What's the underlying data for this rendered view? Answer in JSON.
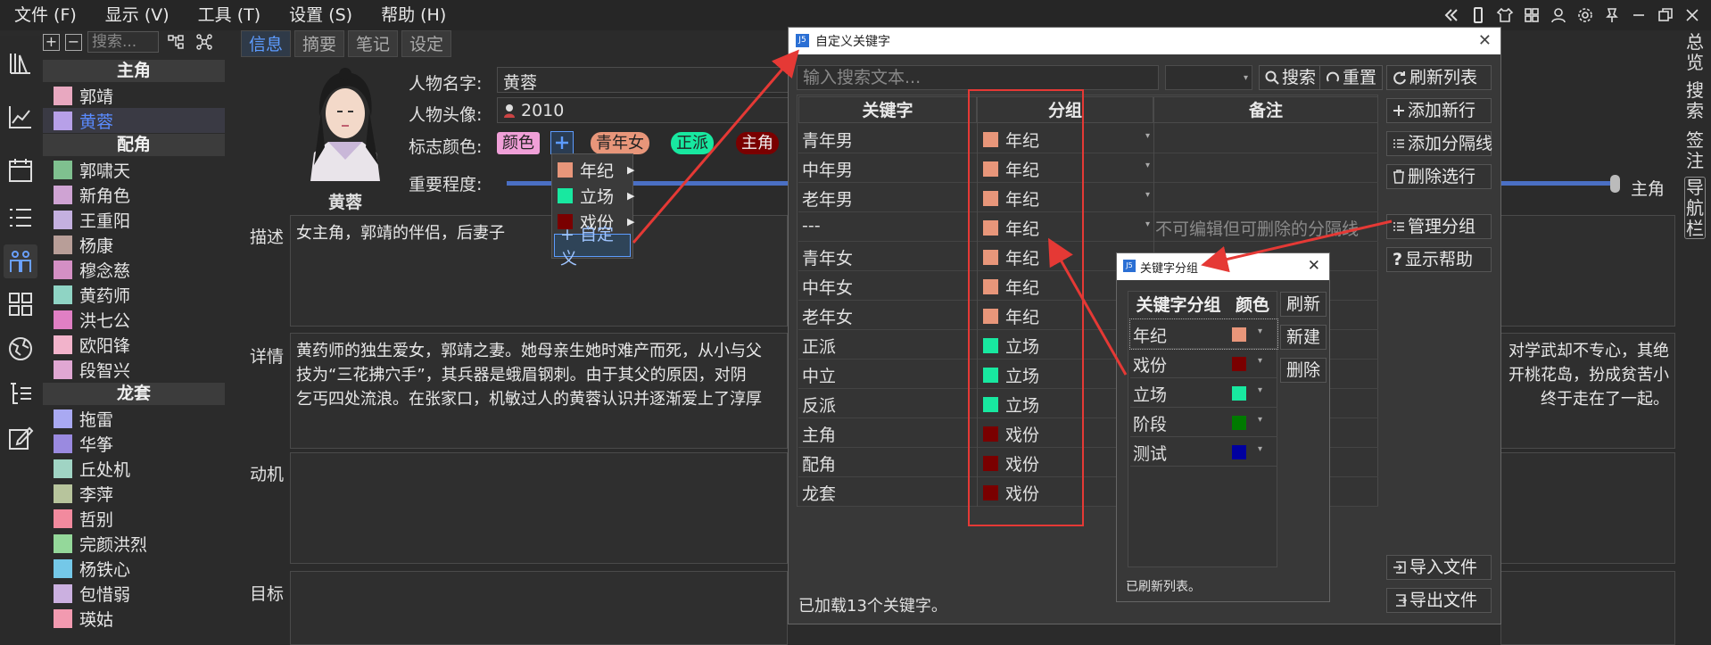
{
  "menubar": {
    "items": [
      "文件 (F)",
      "显示 (V)",
      "工具 (T)",
      "设置 (S)",
      "帮助 (H)"
    ]
  },
  "tree": {
    "search_placeholder": "搜索...",
    "groups": [
      {
        "name": "主角",
        "items": [
          {
            "label": "郭靖",
            "color": "#e8a8c0"
          },
          {
            "label": "黄蓉",
            "color": "#b7a0e8",
            "selected": true
          }
        ]
      },
      {
        "name": "配角",
        "items": [
          {
            "label": "郭啸天",
            "color": "#7fc08f"
          },
          {
            "label": "新角色",
            "color": "#cfa3d3"
          },
          {
            "label": "王重阳",
            "color": "#c4b0e0"
          },
          {
            "label": "杨康",
            "color": "#b89e98"
          },
          {
            "label": "穆念慈",
            "color": "#d48fc4"
          },
          {
            "label": "黄药师",
            "color": "#8fd4c4"
          },
          {
            "label": "洪七公",
            "color": "#e07fc4"
          },
          {
            "label": "欧阳锋",
            "color": "#f2b3cb"
          },
          {
            "label": "段智兴",
            "color": "#e0a7d3"
          }
        ]
      },
      {
        "name": "龙套",
        "items": [
          {
            "label": "拖雷",
            "color": "#a9a9f2"
          },
          {
            "label": "华筝",
            "color": "#9a8ae0"
          },
          {
            "label": "丘处机",
            "color": "#a0d4c4"
          },
          {
            "label": "李萍",
            "color": "#b7c49c"
          },
          {
            "label": "哲别",
            "color": "#f28a9e"
          },
          {
            "label": "完颜洪烈",
            "color": "#94d89a"
          },
          {
            "label": "杨铁心",
            "color": "#74c8e8"
          },
          {
            "label": "包惜弱",
            "color": "#cbb0e0"
          },
          {
            "label": "瑛姑",
            "color": "#f29ab0"
          }
        ]
      }
    ]
  },
  "tabs": [
    "信息",
    "摘要",
    "笔记",
    "设定"
  ],
  "info": {
    "avatar_name": "黄蓉",
    "name_label": "人物名字:",
    "name_value": "黄蓉",
    "avatar_label": "人物头像:",
    "avatar_value": "2010",
    "color_label": "标志颜色:",
    "tags": [
      {
        "label": "颜色",
        "bg": "#f0a0d8",
        "fg": "#222"
      },
      {
        "label": "青年女",
        "bg": "#e8967a",
        "fg": "#222"
      },
      {
        "label": "正派",
        "bg": "#18e8a0",
        "fg": "#222"
      },
      {
        "label": "主角",
        "bg": "#7a0000",
        "fg": "#f0f0f0"
      }
    ],
    "importance_label": "重要程度:",
    "importance_value": "主角",
    "importance_fraction": 1.0,
    "desc_label": "描述",
    "desc_text": "女主角，郭靖的伴侣，后妻子",
    "detail_label": "详情",
    "detail_line1a": "黄药师的独生爱女，郭靖之妻。她母亲生她时难产而死，从小与父",
    "detail_line1b": "对学武却不专心，其绝",
    "detail_line2a": "技为“三花拂穴手”，其兵器是蛾眉钢刺。由于其父的原因，对阴",
    "detail_line2b": "开桃花岛，扮成贫苦小",
    "detail_line3a": "乞丐四处流浪。在张家口，机敏过人的黄蓉认识并逐渐爱上了淳厚",
    "detail_line3b": "终于走在了一起。",
    "motive_label": "动机",
    "goal_label": "目标"
  },
  "color_menu": [
    {
      "label": "年纪",
      "color": "#e8967a"
    },
    {
      "label": "立场",
      "color": "#18e8a0"
    },
    {
      "label": "戏份",
      "color": "#7a0000"
    },
    {
      "label": "+ 自定义"
    }
  ],
  "keyword_dialog": {
    "title": "自定义关键字",
    "search_placeholder": "输入搜索文本...",
    "search_button": "搜索",
    "reset_button": "重置",
    "refresh_button": "刷新列表",
    "add_button": "添加新行",
    "add_sep_button": "添加分隔线",
    "delete_button": "删除选行",
    "manage_button": "管理分组",
    "help_button": "显示帮助",
    "import_button": "导入文件",
    "export_button": "导出文件",
    "columns": [
      "关键字",
      "分组",
      "备注"
    ],
    "rows": [
      {
        "keyword": "青年男",
        "group": "年纪",
        "color": "#e8967a",
        "note": ""
      },
      {
        "keyword": "中年男",
        "group": "年纪",
        "color": "#e8967a",
        "note": ""
      },
      {
        "keyword": "老年男",
        "group": "年纪",
        "color": "#e8967a",
        "note": ""
      },
      {
        "keyword": "---",
        "group": "年纪",
        "color": "#e8967a",
        "note": "不可编辑但可删除的分隔线"
      },
      {
        "keyword": "青年女",
        "group": "年纪",
        "color": "#e8967a",
        "note": ""
      },
      {
        "keyword": "中年女",
        "group": "年纪",
        "color": "#e8967a",
        "note": ""
      },
      {
        "keyword": "老年女",
        "group": "年纪",
        "color": "#e8967a",
        "note": ""
      },
      {
        "keyword": "正派",
        "group": "立场",
        "color": "#18e8a0",
        "note": ""
      },
      {
        "keyword": "中立",
        "group": "立场",
        "color": "#18e8a0",
        "note": ""
      },
      {
        "keyword": "反派",
        "group": "立场",
        "color": "#18e8a0",
        "note": ""
      },
      {
        "keyword": "主角",
        "group": "戏份",
        "color": "#7a0000",
        "note": ""
      },
      {
        "keyword": "配角",
        "group": "戏份",
        "color": "#7a0000",
        "note": ""
      },
      {
        "keyword": "龙套",
        "group": "戏份",
        "color": "#7a0000",
        "note": ""
      }
    ],
    "status": "已加载13个关键字。"
  },
  "group_dialog": {
    "title": "关键字分组",
    "columns": [
      "关键字分组",
      "颜色"
    ],
    "rows": [
      {
        "name": "年纪",
        "color": "#e8967a"
      },
      {
        "name": "戏份",
        "color": "#7a0000"
      },
      {
        "name": "立场",
        "color": "#18e8a0"
      },
      {
        "name": "阶段",
        "color": "#007a00"
      },
      {
        "name": "测试",
        "color": "#0000a0"
      }
    ],
    "refresh_button": "刷新",
    "new_button": "新建",
    "delete_button": "删除",
    "status": "已刷新列表。"
  },
  "right_nav": [
    "总览",
    "搜索",
    "签注",
    "导航栏"
  ],
  "colors": {
    "accent": "#5d9cff",
    "highlight_red": "#e53935"
  }
}
